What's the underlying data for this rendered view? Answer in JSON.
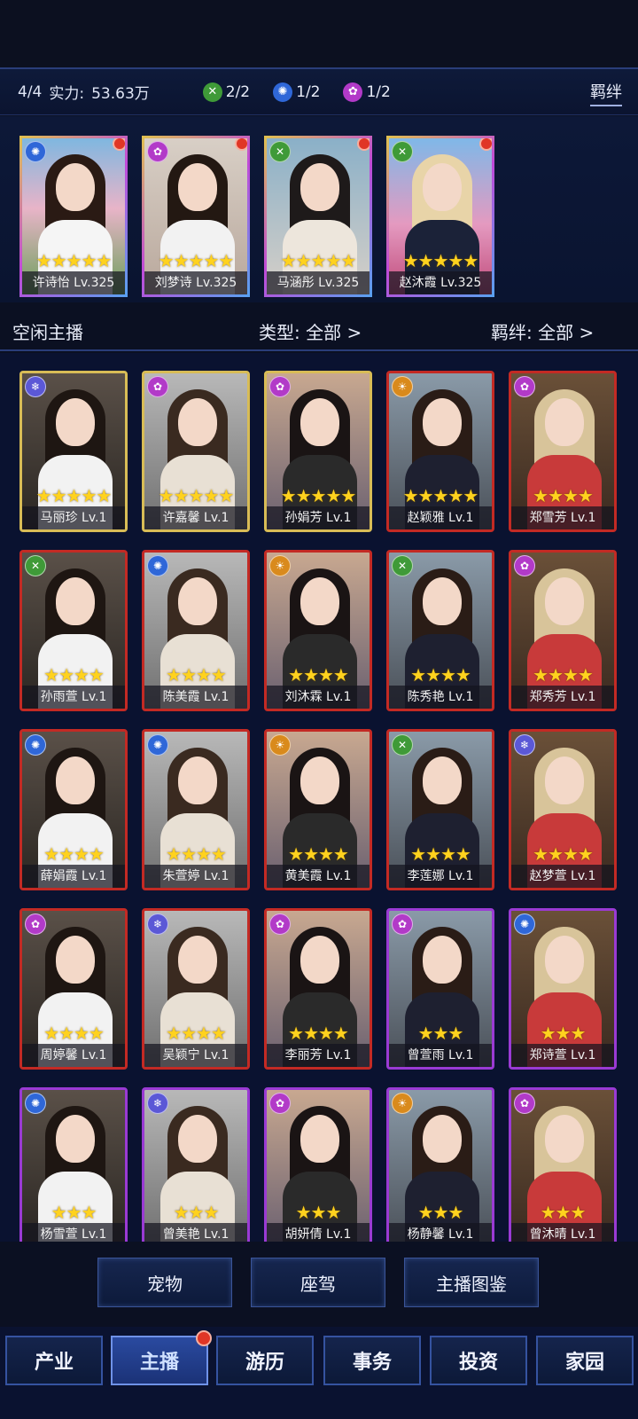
{
  "header": {
    "count": "4/4",
    "power_label": "实力:",
    "power_value": "53.63万",
    "elements": [
      {
        "icon": "wind-element-icon",
        "value": "2/2",
        "color": "#3f9a38"
      },
      {
        "icon": "water-element-icon",
        "value": "1/2",
        "color": "#2f67d8"
      },
      {
        "icon": "arcane-element-icon",
        "value": "1/2",
        "color": "#b23ac8"
      }
    ],
    "bond_label": "羁绊"
  },
  "team": [
    {
      "name": "许诗怡 Lv.325",
      "stars": "★★★★★",
      "element": "water"
    },
    {
      "name": "刘梦诗 Lv.325",
      "stars": "★★★★★",
      "element": "arcane"
    },
    {
      "name": "马涵彤 Lv.325",
      "stars": "★★★★★",
      "element": "wind"
    },
    {
      "name": "赵沐霞 Lv.325",
      "stars": "★★★★★",
      "element": "wind"
    }
  ],
  "idle": {
    "title": "空闲主播",
    "type_filter": "类型: 全部 >",
    "bond_filter": "羁绊: 全部 >"
  },
  "cards": [
    {
      "name": "马丽珍 Lv.1",
      "stars": "★★★★★",
      "element": "ice",
      "frame": "gold"
    },
    {
      "name": "许嘉馨 Lv.1",
      "stars": "★★★★★",
      "element": "arcane",
      "frame": "gold"
    },
    {
      "name": "孙娟芳 Lv.1",
      "stars": "★★★★★",
      "element": "arcane",
      "frame": "gold"
    },
    {
      "name": "赵颖雅 Lv.1",
      "stars": "★★★★★",
      "element": "sun",
      "frame": "red"
    },
    {
      "name": "郑雪芳 Lv.1",
      "stars": "★★★★",
      "element": "arcane",
      "frame": "red"
    },
    {
      "name": "孙雨萱 Lv.1",
      "stars": "★★★★",
      "element": "wind",
      "frame": "red"
    },
    {
      "name": "陈美霞 Lv.1",
      "stars": "★★★★",
      "element": "water",
      "frame": "red"
    },
    {
      "name": "刘沐霖 Lv.1",
      "stars": "★★★★",
      "element": "sun",
      "frame": "red"
    },
    {
      "name": "陈秀艳 Lv.1",
      "stars": "★★★★",
      "element": "wind",
      "frame": "red"
    },
    {
      "name": "郑秀芳 Lv.1",
      "stars": "★★★★",
      "element": "arcane",
      "frame": "red"
    },
    {
      "name": "薛娟霞 Lv.1",
      "stars": "★★★★",
      "element": "water",
      "frame": "red"
    },
    {
      "name": "朱萱婷 Lv.1",
      "stars": "★★★★",
      "element": "water",
      "frame": "red"
    },
    {
      "name": "黄美霞 Lv.1",
      "stars": "★★★★",
      "element": "sun",
      "frame": "red"
    },
    {
      "name": "李莲娜 Lv.1",
      "stars": "★★★★",
      "element": "wind",
      "frame": "red"
    },
    {
      "name": "赵梦萱 Lv.1",
      "stars": "★★★★",
      "element": "ice",
      "frame": "red"
    },
    {
      "name": "周婷馨 Lv.1",
      "stars": "★★★★",
      "element": "arcane",
      "frame": "red"
    },
    {
      "name": "吴颖宁 Lv.1",
      "stars": "★★★★",
      "element": "ice",
      "frame": "red"
    },
    {
      "name": "李丽芳 Lv.1",
      "stars": "★★★★",
      "element": "arcane",
      "frame": "red"
    },
    {
      "name": "曾萱雨 Lv.1",
      "stars": "★★★",
      "element": "arcane",
      "frame": "purple"
    },
    {
      "name": "郑诗萱 Lv.1",
      "stars": "★★★",
      "element": "water",
      "frame": "purple"
    },
    {
      "name": "杨雪萱 Lv.1",
      "stars": "★★★",
      "element": "water",
      "frame": "purple"
    },
    {
      "name": "曾美艳 Lv.1",
      "stars": "★★★",
      "element": "ice",
      "frame": "purple"
    },
    {
      "name": "胡妍倩 Lv.1",
      "stars": "★★★",
      "element": "arcane",
      "frame": "purple"
    },
    {
      "name": "杨静馨 Lv.1",
      "stars": "★★★",
      "element": "sun",
      "frame": "purple"
    },
    {
      "name": "曾沐晴 Lv.1",
      "stars": "★★★",
      "element": "arcane",
      "frame": "purple"
    }
  ],
  "sub_buttons": [
    "宠物",
    "座驾",
    "主播图鉴"
  ],
  "nav": {
    "items": [
      "产业",
      "主播",
      "游历",
      "事务",
      "投资",
      "家园"
    ],
    "active": "主播"
  }
}
